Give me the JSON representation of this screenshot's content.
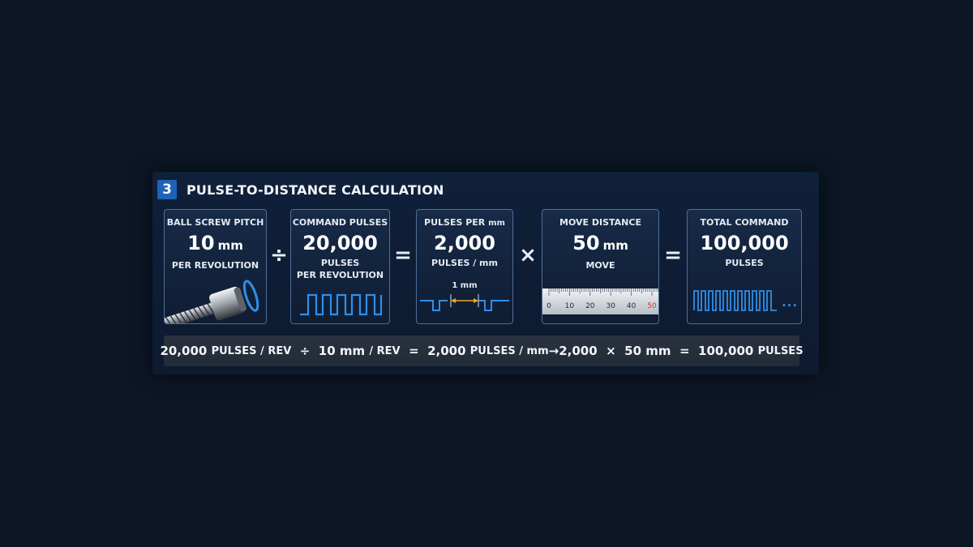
{
  "header": {
    "step_number": "3",
    "title": "PULSE-TO-DISTANCE CALCULATION"
  },
  "cards": {
    "pitch": {
      "label": "BALL SCREW PITCH",
      "value": "10",
      "unit": "mm",
      "sub": "PER REVOLUTION"
    },
    "command": {
      "label": "COMMAND PULSES",
      "value": "20,000",
      "sub1": "PULSES",
      "sub2": "PER REVOLUTION"
    },
    "ppm": {
      "label_main": "PULSES PER",
      "label_unit": "mm",
      "value": "2,000",
      "sub": "PULSES / mm",
      "dimension": "1 mm"
    },
    "move": {
      "label": "MOVE DISTANCE",
      "value": "50",
      "unit": "mm",
      "sub": "MOVE",
      "ruler_ticks": [
        "0",
        "10",
        "20",
        "30",
        "40",
        "50"
      ]
    },
    "total": {
      "label": "TOTAL COMMAND",
      "value": "100,000",
      "sub": "PULSES",
      "ellipsis": "..."
    }
  },
  "operators": {
    "divide": "÷",
    "equals1": "=",
    "multiply": "×",
    "equals2": "="
  },
  "formula": {
    "a": "20,000",
    "a_unit": "PULSES / REV",
    "div": "÷",
    "b": "10 mm",
    "b_unit": "/ REV",
    "eq1": "=",
    "c": "2,000",
    "c_unit": "PULSES / mm",
    "arrow": "→",
    "d": "2,000",
    "mul": "×",
    "e": "50 mm",
    "eq2": "=",
    "f": "100,000",
    "f_unit": "PULSES"
  },
  "colors": {
    "accent": "#1d63b8",
    "pulse_blue": "#2f8fe8",
    "dimension_orange": "#f5a623",
    "ruler_red": "#d0312d"
  }
}
